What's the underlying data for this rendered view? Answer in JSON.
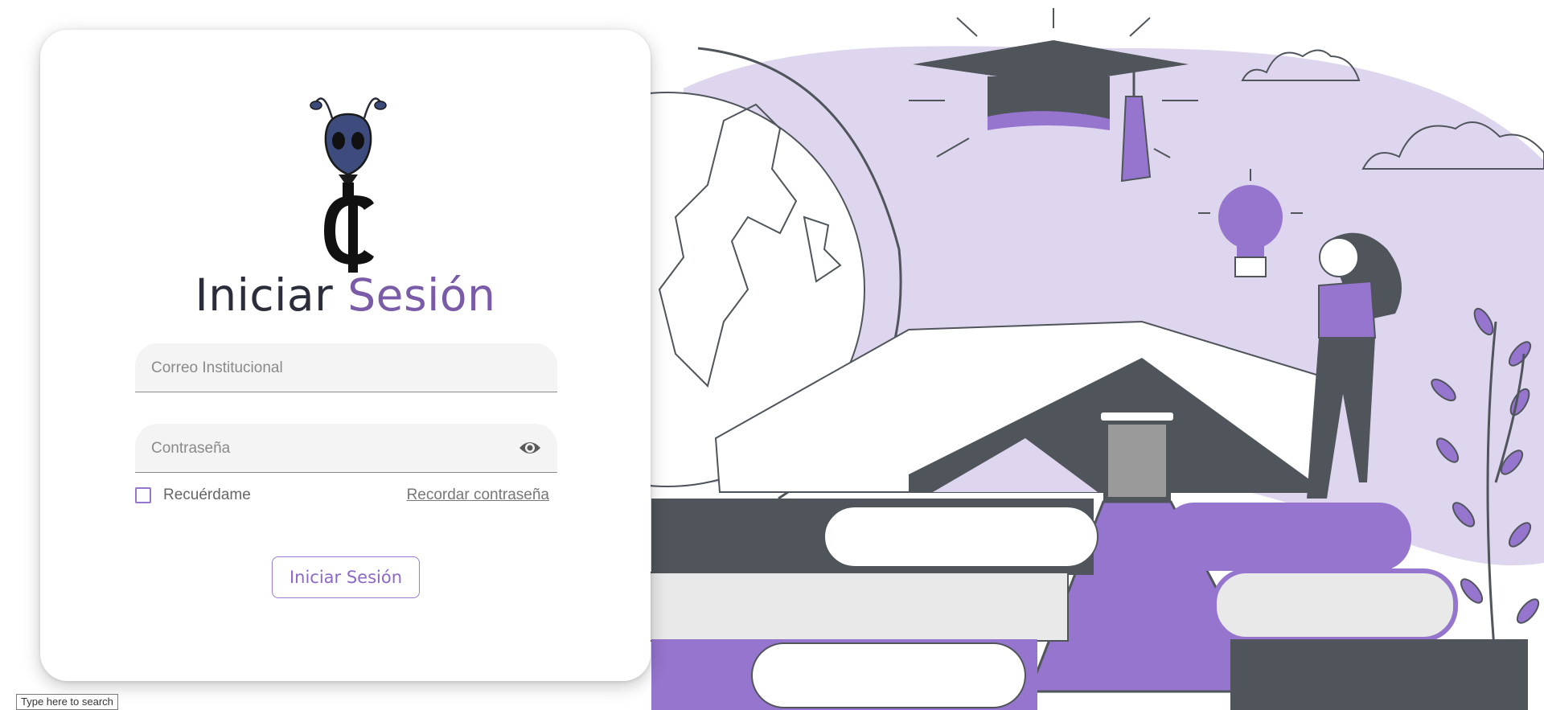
{
  "login": {
    "title_part1": "Iniciar ",
    "title_part2": "Sesión",
    "email_placeholder": "Correo Institucional",
    "email_value": "",
    "password_placeholder": "Contraseña",
    "password_value": "",
    "remember_label": "Recuérdame",
    "remember_checked": false,
    "forgot_link": "Recordar contraseña",
    "submit_label": "Iniciar Sesión"
  },
  "taskbar": {
    "search_placeholder": "Type here to search"
  },
  "icons": {
    "logo": "ant-cent-logo-icon",
    "password_toggle": "eye-icon"
  },
  "colors": {
    "accent": "#7a5ba8",
    "button_text": "#8c68c7",
    "illustration_purple": "#9575cd",
    "illustration_light_purple": "#ded6ef",
    "illustration_dark": "#4f555b"
  }
}
